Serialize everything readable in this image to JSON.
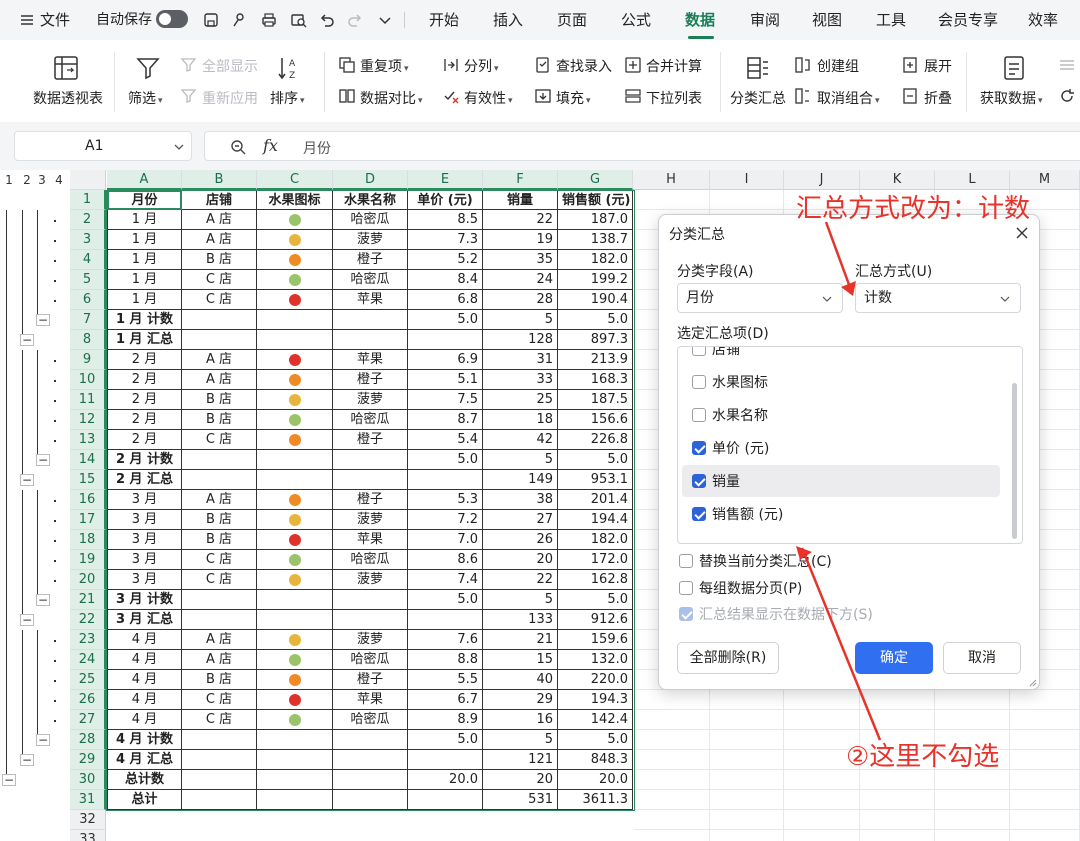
{
  "menubar": {
    "file": "文件",
    "autosave": "自动保存",
    "tabs": [
      "开始",
      "插入",
      "页面",
      "公式",
      "数据",
      "审阅",
      "视图",
      "工具",
      "会员专享",
      "效率"
    ],
    "active_tab": "数据"
  },
  "ribbon": {
    "pivot": "数据透视表",
    "filter": "筛选",
    "show_all": "全部显示",
    "reapply": "重新应用",
    "sort": "排序",
    "duplicates": "重复项",
    "compare": "数据对比",
    "split": "分列",
    "validity": "有效性",
    "lookup_entry": "查找录入",
    "fill": "填充",
    "consolidate": "合并计算",
    "dropdown_list": "下拉列表",
    "subtotal": "分类汇总",
    "group": "创建组",
    "ungroup": "取消组合",
    "expand": "展开",
    "collapse": "折叠",
    "get_data": "获取数据"
  },
  "formula_bar": {
    "cell_ref": "A1",
    "fx": "fx",
    "content": "月份"
  },
  "sheet": {
    "outline_levels": [
      "1",
      "2",
      "3",
      "4"
    ],
    "columns": [
      "A",
      "B",
      "C",
      "D",
      "E",
      "F",
      "G",
      "H",
      "I",
      "J",
      "K",
      "L",
      "M"
    ],
    "rows": [
      {
        "n": "1",
        "cells": [
          "月份",
          "店铺",
          "水果图标",
          "水果名称",
          "单价 (元)",
          "销量",
          "销售额 (元)"
        ],
        "type": "header"
      },
      {
        "n": "2",
        "cells": [
          "1 月",
          "A 店",
          "",
          "哈密瓜",
          "8.5",
          "22",
          "187.0"
        ],
        "fruit": "melon"
      },
      {
        "n": "3",
        "cells": [
          "1 月",
          "A 店",
          "",
          "菠萝",
          "7.3",
          "19",
          "138.7"
        ],
        "fruit": "pineapple"
      },
      {
        "n": "4",
        "cells": [
          "1 月",
          "B 店",
          "",
          "橙子",
          "5.2",
          "35",
          "182.0"
        ],
        "fruit": "orange"
      },
      {
        "n": "5",
        "cells": [
          "1 月",
          "C 店",
          "",
          "哈密瓜",
          "8.4",
          "24",
          "199.2"
        ],
        "fruit": "melon"
      },
      {
        "n": "6",
        "cells": [
          "1 月",
          "C 店",
          "",
          "苹果",
          "6.8",
          "28",
          "190.4"
        ],
        "fruit": "apple"
      },
      {
        "n": "7",
        "cells": [
          "1 月 计数",
          "",
          "",
          "",
          "5.0",
          "5",
          "5.0"
        ],
        "type": "sub"
      },
      {
        "n": "8",
        "cells": [
          "1 月 汇总",
          "",
          "",
          "",
          "",
          "128",
          "897.3"
        ],
        "type": "sub"
      },
      {
        "n": "9",
        "cells": [
          "2 月",
          "A 店",
          "",
          "苹果",
          "6.9",
          "31",
          "213.9"
        ],
        "fruit": "apple"
      },
      {
        "n": "10",
        "cells": [
          "2 月",
          "A 店",
          "",
          "橙子",
          "5.1",
          "33",
          "168.3"
        ],
        "fruit": "orange"
      },
      {
        "n": "11",
        "cells": [
          "2 月",
          "B 店",
          "",
          "菠萝",
          "7.5",
          "25",
          "187.5"
        ],
        "fruit": "pineapple"
      },
      {
        "n": "12",
        "cells": [
          "2 月",
          "B 店",
          "",
          "哈密瓜",
          "8.7",
          "18",
          "156.6"
        ],
        "fruit": "melon"
      },
      {
        "n": "13",
        "cells": [
          "2 月",
          "C 店",
          "",
          "橙子",
          "5.4",
          "42",
          "226.8"
        ],
        "fruit": "orange"
      },
      {
        "n": "14",
        "cells": [
          "2 月 计数",
          "",
          "",
          "",
          "5.0",
          "5",
          "5.0"
        ],
        "type": "sub"
      },
      {
        "n": "15",
        "cells": [
          "2 月 汇总",
          "",
          "",
          "",
          "",
          "149",
          "953.1"
        ],
        "type": "sub"
      },
      {
        "n": "16",
        "cells": [
          "3 月",
          "A 店",
          "",
          "橙子",
          "5.3",
          "38",
          "201.4"
        ],
        "fruit": "orange"
      },
      {
        "n": "17",
        "cells": [
          "3 月",
          "B 店",
          "",
          "菠萝",
          "7.2",
          "27",
          "194.4"
        ],
        "fruit": "pineapple"
      },
      {
        "n": "18",
        "cells": [
          "3 月",
          "B 店",
          "",
          "苹果",
          "7.0",
          "26",
          "182.0"
        ],
        "fruit": "apple"
      },
      {
        "n": "19",
        "cells": [
          "3 月",
          "C 店",
          "",
          "哈密瓜",
          "8.6",
          "20",
          "172.0"
        ],
        "fruit": "melon"
      },
      {
        "n": "20",
        "cells": [
          "3 月",
          "C 店",
          "",
          "菠萝",
          "7.4",
          "22",
          "162.8"
        ],
        "fruit": "pineapple"
      },
      {
        "n": "21",
        "cells": [
          "3 月 计数",
          "",
          "",
          "",
          "5.0",
          "5",
          "5.0"
        ],
        "type": "sub"
      },
      {
        "n": "22",
        "cells": [
          "3 月 汇总",
          "",
          "",
          "",
          "",
          "133",
          "912.6"
        ],
        "type": "sub"
      },
      {
        "n": "23",
        "cells": [
          "4 月",
          "A 店",
          "",
          "菠萝",
          "7.6",
          "21",
          "159.6"
        ],
        "fruit": "pineapple"
      },
      {
        "n": "24",
        "cells": [
          "4 月",
          "A 店",
          "",
          "哈密瓜",
          "8.8",
          "15",
          "132.0"
        ],
        "fruit": "melon"
      },
      {
        "n": "25",
        "cells": [
          "4 月",
          "B 店",
          "",
          "橙子",
          "5.5",
          "40",
          "220.0"
        ],
        "fruit": "orange"
      },
      {
        "n": "26",
        "cells": [
          "4 月",
          "C 店",
          "",
          "苹果",
          "6.7",
          "29",
          "194.3"
        ],
        "fruit": "apple"
      },
      {
        "n": "27",
        "cells": [
          "4 月",
          "C 店",
          "",
          "哈密瓜",
          "8.9",
          "16",
          "142.4"
        ],
        "fruit": "melon"
      },
      {
        "n": "28",
        "cells": [
          "4 月 计数",
          "",
          "",
          "",
          "5.0",
          "5",
          "5.0"
        ],
        "type": "sub"
      },
      {
        "n": "29",
        "cells": [
          "4 月 汇总",
          "",
          "",
          "",
          "",
          "121",
          "848.3"
        ],
        "type": "sub"
      },
      {
        "n": "30",
        "cells": [
          "总计数",
          "",
          "",
          "",
          "20.0",
          "20",
          "20.0"
        ],
        "type": "sub"
      },
      {
        "n": "31",
        "cells": [
          "总计",
          "",
          "",
          "",
          "",
          "531",
          "3611.3"
        ],
        "type": "sub"
      },
      {
        "n": "32",
        "cells": []
      },
      {
        "n": "33",
        "cells": []
      }
    ],
    "fruit_colors": {
      "melon": "#9bc46a",
      "pineapple": "#e9b43c",
      "orange": "#f08a24",
      "apple": "#e0312a"
    }
  },
  "dialog": {
    "title": "分类汇总",
    "field_label": "分类字段(A)",
    "field_value": "月份",
    "method_label": "汇总方式(U)",
    "method_value": "计数",
    "items_label": "选定汇总项(D)",
    "items": [
      {
        "label": "店铺",
        "checked": false
      },
      {
        "label": "水果图标",
        "checked": false
      },
      {
        "label": "水果名称",
        "checked": false
      },
      {
        "label": "单价 (元)",
        "checked": true
      },
      {
        "label": "销量",
        "checked": true
      },
      {
        "label": "销售额 (元)",
        "checked": true
      }
    ],
    "replace_label": "替换当前分类汇总(C)",
    "pagebreak_label": "每组数据分页(P)",
    "below_label": "汇总结果显示在数据下方(S)",
    "delete_all": "全部删除(R)",
    "ok": "确定",
    "cancel": "取消"
  },
  "annotations": {
    "top": "汇总方式改为：计数",
    "bottom": "②这里不勾选",
    "color": "#e8332a"
  }
}
